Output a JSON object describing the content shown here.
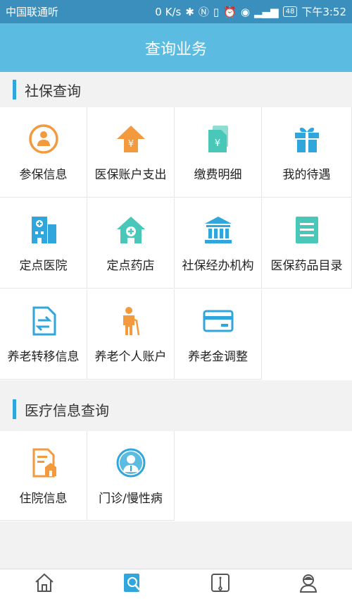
{
  "status_bar": {
    "carrier": "中国联通",
    "carrier_suffix": "听",
    "speed": "0 K/s",
    "battery": "48",
    "time": "下午3:52"
  },
  "header": {
    "title": "查询业务"
  },
  "sections": [
    {
      "title": "社保查询",
      "items": [
        {
          "label": "参保信息",
          "icon": "person-circle-icon"
        },
        {
          "label": "医保账户支出",
          "icon": "yuan-arrow-up-icon"
        },
        {
          "label": "缴费明细",
          "icon": "yuan-document-icon"
        },
        {
          "label": "我的待遇",
          "icon": "gift-icon"
        },
        {
          "label": "定点医院",
          "icon": "hospital-building-icon"
        },
        {
          "label": "定点药店",
          "icon": "pharmacy-house-icon"
        },
        {
          "label": "社保经办机构",
          "icon": "institution-building-icon"
        },
        {
          "label": "医保药品目录",
          "icon": "list-document-icon"
        },
        {
          "label": "养老转移信息",
          "icon": "transfer-document-icon"
        },
        {
          "label": "养老个人账户",
          "icon": "elderly-person-icon"
        },
        {
          "label": "养老金调整",
          "icon": "card-icon"
        }
      ]
    },
    {
      "title": "医疗信息查询",
      "items": [
        {
          "label": "住院信息",
          "icon": "inpatient-document-icon"
        },
        {
          "label": "门诊/慢性病",
          "icon": "doctor-avatar-icon"
        }
      ]
    }
  ],
  "bottom_nav": [
    {
      "name": "home",
      "icon": "home-icon",
      "active": false
    },
    {
      "name": "query",
      "icon": "search-document-icon",
      "active": true
    },
    {
      "name": "business",
      "icon": "briefcase-icon",
      "active": false
    },
    {
      "name": "profile",
      "icon": "user-icon",
      "active": false
    }
  ],
  "colors": {
    "header": "#5bbbe0",
    "statusbar": "#3a8fbd",
    "accent_blue": "#31a6dd",
    "orange": "#f39a3f",
    "teal": "#49c8b9"
  }
}
